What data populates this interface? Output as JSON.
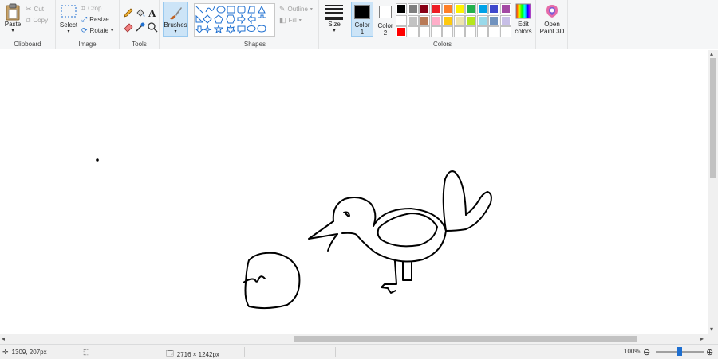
{
  "clipboard": {
    "paste_label": "Paste",
    "cut_label": "Cut",
    "copy_label": "Copy",
    "group_label": "Clipboard"
  },
  "image": {
    "select_label": "Select",
    "crop_label": "Crop",
    "resize_label": "Resize",
    "rotate_label": "Rotate",
    "group_label": "Image"
  },
  "tools": {
    "group_label": "Tools"
  },
  "brushes": {
    "label": "Brushes"
  },
  "shapes": {
    "outline_label": "Outline",
    "fill_label": "Fill",
    "group_label": "Shapes"
  },
  "size": {
    "label": "Size"
  },
  "colors": {
    "color1_label": "Color",
    "color1_number": "1",
    "color2_label": "Color",
    "color2_number": "2",
    "group_label": "Colors",
    "edit_label": "Edit colors",
    "color1": "#000000",
    "color2": "#ffffff",
    "palette_row1": [
      "#000000",
      "#7f7f7f",
      "#880015",
      "#ed1c24",
      "#ff7f27",
      "#fff200",
      "#22b14c",
      "#00a2e8",
      "#3f48cc",
      "#a349a4"
    ],
    "palette_row2": [
      "#ffffff",
      "#c3c3c3",
      "#b97a57",
      "#ffaec9",
      "#ffc90e",
      "#efe4b0",
      "#b5e61d",
      "#99d9ea",
      "#7092be",
      "#c8bfe7"
    ],
    "palette_row3": [
      "#ff0000",
      "#ffffff",
      "#ffffff",
      "#ffffff",
      "#ffffff",
      "#ffffff",
      "#ffffff",
      "#ffffff",
      "#ffffff",
      "#ffffff"
    ]
  },
  "paint3d": {
    "label": "Open Paint 3D"
  },
  "status": {
    "cursor_position": "1309, 207px",
    "image_size": "2716 × 1242px",
    "zoom": "100%"
  }
}
